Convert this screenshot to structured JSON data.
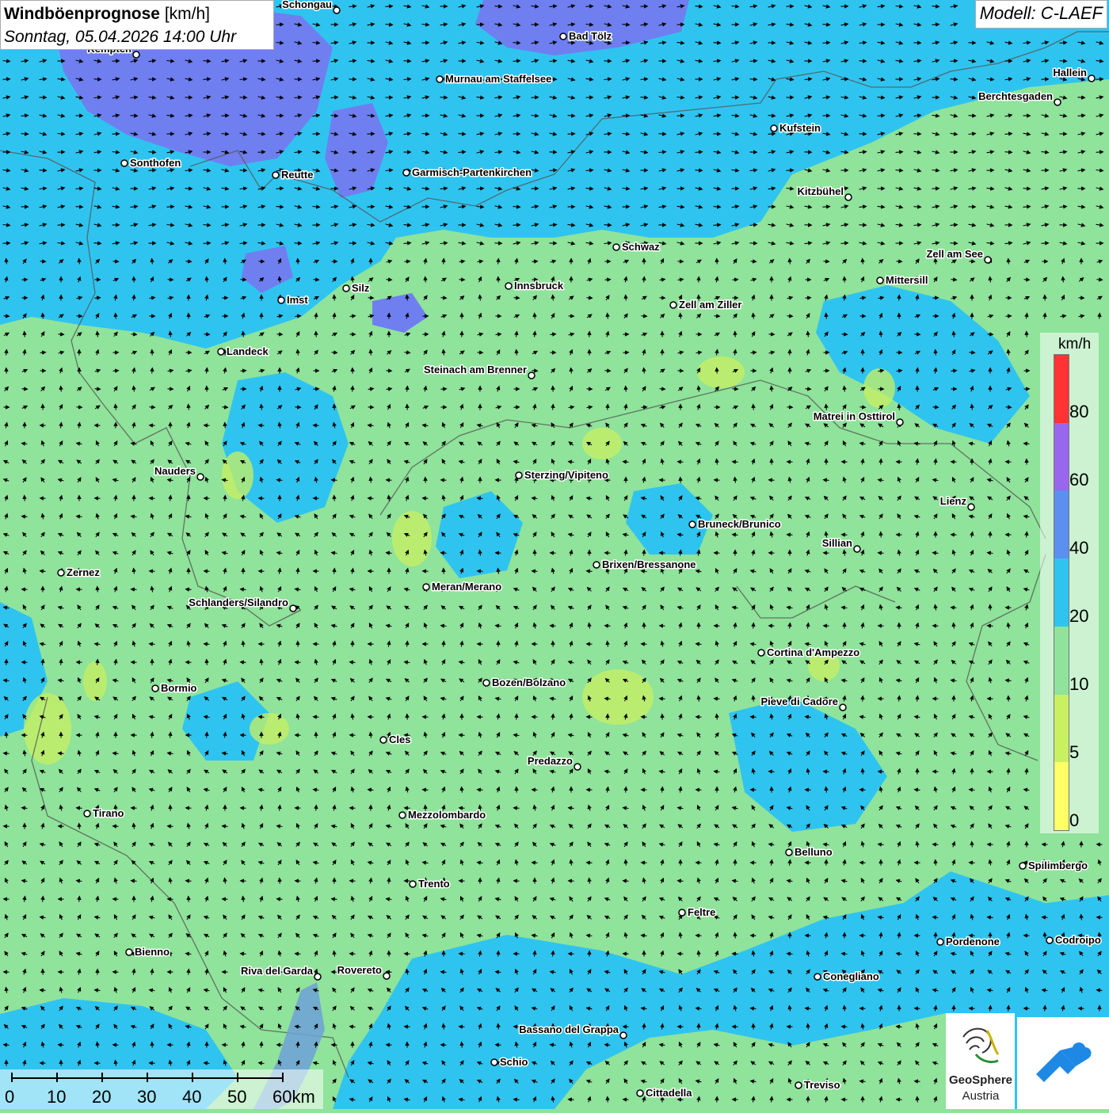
{
  "header": {
    "title": "Windböenprognose",
    "unit": "[km/h]",
    "datetime": "Sonntag, 05.04.2026 14:00 Uhr",
    "model": "Modell: C-LAEF"
  },
  "legend": {
    "unit": "km/h",
    "ticks": [
      "80",
      "60",
      "40",
      "20",
      "10",
      "5",
      "0"
    ],
    "colors": [
      "#ff3333",
      "#9966ee",
      "#5b8ff0",
      "#2fc4f0",
      "#8fe39a",
      "#c8f060",
      "#ffff66"
    ]
  },
  "scale_bar": {
    "labels": [
      "0",
      "10",
      "20",
      "30",
      "40",
      "50",
      "60km"
    ]
  },
  "logos": {
    "geosphere_line1": "GeoSphere",
    "geosphere_line2": "Austria"
  },
  "cities": [
    {
      "name": "Schongau"
    },
    {
      "name": "Bad Tölz"
    },
    {
      "name": "Kempten"
    },
    {
      "name": "Murnau am Staffelsee"
    },
    {
      "name": "Hallein"
    },
    {
      "name": "Berchtesgaden"
    },
    {
      "name": "Kufstein"
    },
    {
      "name": "Sonthofen"
    },
    {
      "name": "Reutte"
    },
    {
      "name": "Garmisch-Partenkirchen"
    },
    {
      "name": "Kitzbühel"
    },
    {
      "name": "Schwaz"
    },
    {
      "name": "Zell am See"
    },
    {
      "name": "Mittersill"
    },
    {
      "name": "Innsbruck"
    },
    {
      "name": "Silz"
    },
    {
      "name": "Imst"
    },
    {
      "name": "Zell am Ziller"
    },
    {
      "name": "Landeck"
    },
    {
      "name": "Steinach am Brenner"
    },
    {
      "name": "Matrei in Osttirol"
    },
    {
      "name": "Nauders"
    },
    {
      "name": "Sterzing/Vipiteno"
    },
    {
      "name": "Lienz"
    },
    {
      "name": "Bruneck/Brunico"
    },
    {
      "name": "Sillian"
    },
    {
      "name": "Brixen/Bressanone"
    },
    {
      "name": "Zernez"
    },
    {
      "name": "Meran/Merano"
    },
    {
      "name": "Schlanders/Silandro"
    },
    {
      "name": "Cortina d'Ampezzo"
    },
    {
      "name": "Bozen/Bolzano"
    },
    {
      "name": "Bormio"
    },
    {
      "name": "Pieve di Cadore"
    },
    {
      "name": "Cles"
    },
    {
      "name": "Predazzo"
    },
    {
      "name": "Tirano"
    },
    {
      "name": "Mezzolombardo"
    },
    {
      "name": "Belluno"
    },
    {
      "name": "Spilimbergo"
    },
    {
      "name": "Trento"
    },
    {
      "name": "Feltre"
    },
    {
      "name": "Pordenone"
    },
    {
      "name": "Codroipo"
    },
    {
      "name": "Bienno"
    },
    {
      "name": "Riva del Garda"
    },
    {
      "name": "Rovereto"
    },
    {
      "name": "Conegliano"
    },
    {
      "name": "Bassano del Grappa"
    },
    {
      "name": "Schio"
    },
    {
      "name": "Treviso"
    },
    {
      "name": "Cittadella"
    }
  ]
}
